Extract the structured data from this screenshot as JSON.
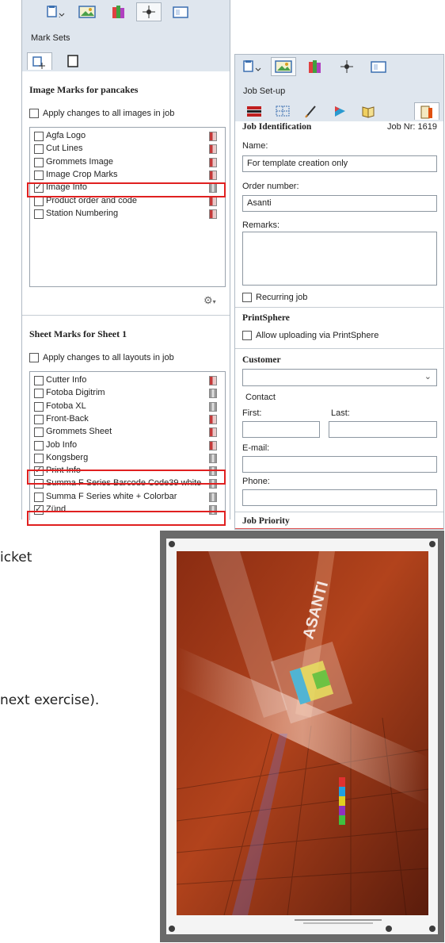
{
  "left_panel": {
    "toolbar_icons": [
      "document-dropdown-icon",
      "image-icon",
      "color-swatch-icon",
      "crosshair-mark-icon",
      "layout-icon"
    ],
    "title": "Mark Sets",
    "subtab_icons": [
      "mark-set-icon",
      "page-icon"
    ],
    "image_marks": {
      "heading": "Image Marks for pancakes",
      "apply_all": "Apply changes to all images in job",
      "items": [
        {
          "label": "Agfa Logo",
          "checked": false,
          "icon": "red"
        },
        {
          "label": "Cut Lines",
          "checked": false,
          "icon": "red"
        },
        {
          "label": "Grommets Image",
          "checked": false,
          "icon": "red"
        },
        {
          "label": "Image Crop Marks",
          "checked": false,
          "icon": "red"
        },
        {
          "label": "Image Info",
          "checked": true,
          "icon": "grey"
        },
        {
          "label": "Product order and code",
          "checked": false,
          "icon": "red"
        },
        {
          "label": "Station Numbering",
          "checked": false,
          "icon": "red"
        }
      ],
      "settings_icon": "gear-icon"
    },
    "sheet_marks": {
      "heading": "Sheet Marks for Sheet 1",
      "apply_all": "Apply changes to all layouts in job",
      "items": [
        {
          "label": "Cutter Info",
          "checked": false,
          "icon": "red"
        },
        {
          "label": "Fotoba Digitrim",
          "checked": false,
          "icon": "grey"
        },
        {
          "label": "Fotoba XL",
          "checked": false,
          "icon": "grey"
        },
        {
          "label": "Front-Back",
          "checked": false,
          "icon": "red"
        },
        {
          "label": "Grommets Sheet",
          "checked": false,
          "icon": "red"
        },
        {
          "label": "Job Info",
          "checked": false,
          "icon": "red"
        },
        {
          "label": "Kongsberg",
          "checked": false,
          "icon": "grey"
        },
        {
          "label": "Print Info",
          "checked": true,
          "icon": "grey"
        },
        {
          "label": "Summa F Series Barcode Code39 white",
          "checked": false,
          "icon": "grey"
        },
        {
          "label": "Summa F Series white + Colorbar",
          "checked": false,
          "icon": "grey"
        },
        {
          "label": "Zünd",
          "checked": true,
          "icon": "grey"
        }
      ]
    }
  },
  "right_panel": {
    "title": "Job Set-up",
    "job_identification": "Job Identification",
    "job_nr": "Job Nr: 1619",
    "name_label": "Name:",
    "name_value": "For template creation only",
    "order_label": "Order number:",
    "order_value": "Asanti",
    "remarks_label": "Remarks:",
    "recurring_label": "Recurring job",
    "printsphere_heading": "PrintSphere",
    "printsphere_upload": "Allow uploading via PrintSphere",
    "customer_heading": "Customer",
    "contact_label": "Contact",
    "first_label": "First:",
    "last_label": "Last:",
    "email_label": "E-mail:",
    "phone_label": "Phone:",
    "priority_heading": "Job Priority"
  },
  "background_text": {
    "fragment1": "icket",
    "fragment2": "next exercise)."
  },
  "poster": {
    "brand_text": "ASANTI"
  }
}
